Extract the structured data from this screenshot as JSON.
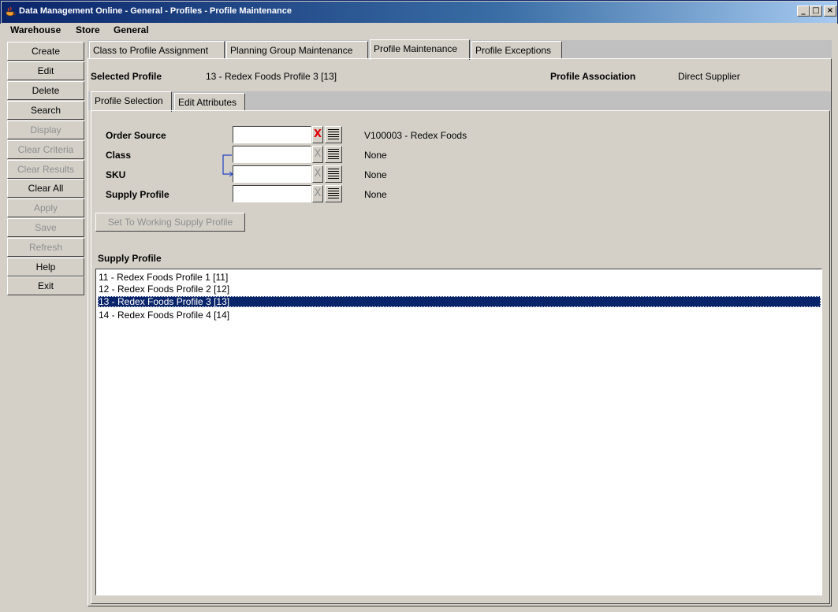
{
  "window": {
    "title": "Data Management Online - General - Profiles - Profile Maintenance",
    "icon": "java-cup-icon",
    "controls": [
      "_",
      "□",
      "×"
    ]
  },
  "menu": [
    "Warehouse",
    "Store",
    "General"
  ],
  "left_buttons": [
    {
      "label": "Create",
      "enabled": true
    },
    {
      "label": "Edit",
      "enabled": true
    },
    {
      "label": "Delete",
      "enabled": true
    },
    {
      "label": "Search",
      "enabled": true
    },
    {
      "label": "Display",
      "enabled": false
    },
    {
      "label": "Clear Criteria",
      "enabled": false
    },
    {
      "label": "Clear Results",
      "enabled": false
    },
    {
      "label": "Clear All",
      "enabled": true
    },
    {
      "label": "Apply",
      "enabled": false
    },
    {
      "label": "Save",
      "enabled": false
    },
    {
      "label": "Refresh",
      "enabled": false
    },
    {
      "label": "Help",
      "enabled": true
    },
    {
      "label": "Exit",
      "enabled": true
    }
  ],
  "tabs": [
    "Class to Profile Assignment",
    "Planning Group Maintenance",
    "Profile Maintenance",
    "Profile Exceptions"
  ],
  "active_tab": "Profile Maintenance",
  "header": {
    "selected_profile_label": "Selected Profile",
    "selected_profile_value": "13 - Redex Foods Profile 3 [13]",
    "association_label": "Profile Association",
    "association_value": "Direct Supplier"
  },
  "sub_tabs": [
    "Profile Selection",
    "Edit Attributes"
  ],
  "active_sub_tab": "Profile Selection",
  "criteria": [
    {
      "label": "Order Source",
      "value": "",
      "description": "V100003 - Redex Foods",
      "clear": "X"
    },
    {
      "label": "Class",
      "value": "",
      "description": "None",
      "clear": "X"
    },
    {
      "label": "SKU",
      "value": "",
      "description": "None",
      "clear": "X"
    },
    {
      "label": "Supply Profile",
      "value": "",
      "description": "None",
      "clear": "X"
    }
  ],
  "set_working_label": "Set To Working Supply Profile",
  "supply_profile_label": "Supply Profile",
  "supply_profiles": [
    "11 - Redex Foods Profile 1 [11]",
    "12 - Redex Foods Profile 2 [12]",
    "13 - Redex Foods Profile 3 [13]",
    "14 - Redex Foods Profile 4 [14]"
  ],
  "selected_profile_index": 2,
  "colors": {
    "selection": "#0a246a",
    "title_bar": "#0a246a",
    "clear_active": "#e00000"
  }
}
